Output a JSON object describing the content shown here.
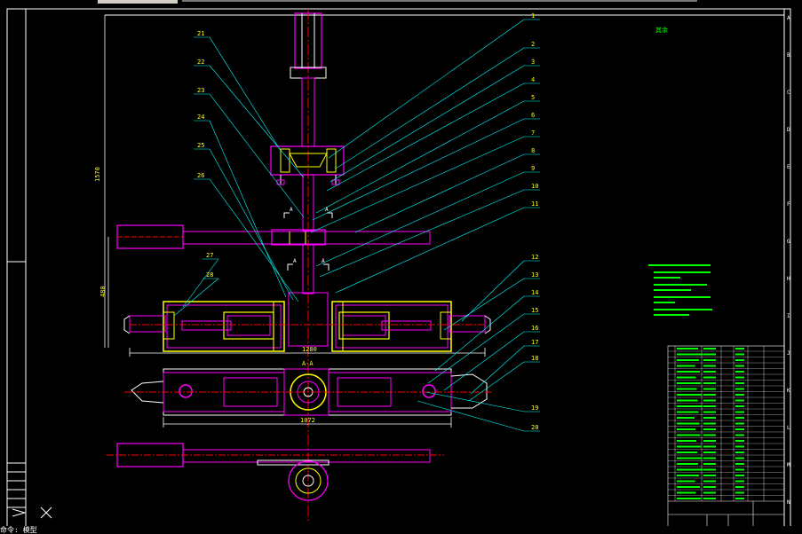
{
  "window": {
    "command_prompt": "命令: 模型"
  },
  "drawing": {
    "balloons_right": [
      "1",
      "2",
      "3",
      "4",
      "5",
      "6",
      "7",
      "8",
      "9",
      "10",
      "11",
      "12",
      "13",
      "14",
      "15",
      "16",
      "17",
      "18",
      "19",
      "20"
    ],
    "balloons_left": [
      "21",
      "22",
      "23",
      "24",
      "25",
      "26",
      "27",
      "28"
    ],
    "dimensions": {
      "overall_height": "1570",
      "lower_height": "480",
      "upper_width": "1280",
      "lower_width": "1072"
    },
    "border_letters_right": [
      "A",
      "B",
      "C",
      "D",
      "E",
      "F",
      "G",
      "H",
      "I",
      "J",
      "K",
      "L",
      "M",
      "N"
    ],
    "section_marks": [
      "A",
      "A",
      "A",
      "A"
    ],
    "view_title": "A-A",
    "surface_finish": "其余"
  },
  "colors": {
    "background": "#000000",
    "frame": "#ffffff",
    "leader": "#00ffff",
    "part_outline": "#ff00ff",
    "hatch": "#ffff00",
    "centerline": "#ff0000",
    "notes": "#00ff00"
  }
}
